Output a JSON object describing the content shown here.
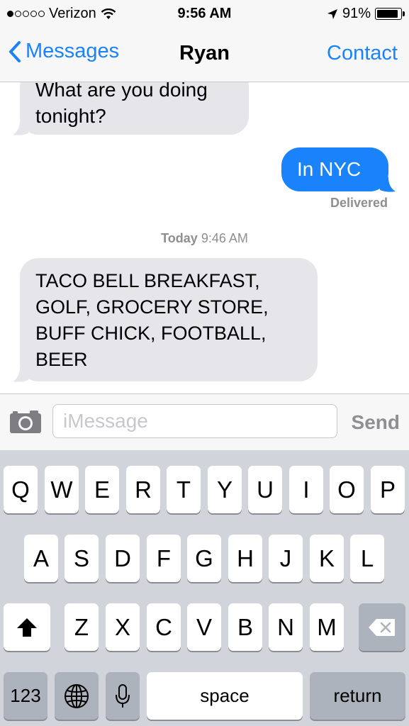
{
  "status_bar": {
    "carrier": "Verizon",
    "signal_bars": 1,
    "time": "9:56 AM",
    "battery": "91%",
    "battery_level": 0.91
  },
  "nav": {
    "back_label": "Messages",
    "title": "Ryan",
    "right_label": "Contact"
  },
  "messages": [
    {
      "direction": "incoming",
      "lines": [
        "What are you doing",
        "tonight?"
      ]
    },
    {
      "direction": "outgoing",
      "text": "In NYC",
      "status": "Delivered"
    },
    {
      "direction": "incoming",
      "lines": [
        "TACO BELL BREAKFAST,",
        "GOLF, GROCERY STORE,",
        "BUFF CHICK, FOOTBALL,",
        "BEER"
      ]
    }
  ],
  "timestamp": {
    "day": "Today",
    "time": "9:46 AM"
  },
  "input": {
    "placeholder": "iMessage",
    "send_label": "Send"
  },
  "keyboard": {
    "row1": [
      "Q",
      "W",
      "E",
      "R",
      "T",
      "Y",
      "U",
      "I",
      "O",
      "P"
    ],
    "row2": [
      "A",
      "S",
      "D",
      "F",
      "G",
      "H",
      "J",
      "K",
      "L"
    ],
    "row3": [
      "Z",
      "X",
      "C",
      "V",
      "B",
      "N",
      "M"
    ],
    "numbers_label": "123",
    "space_label": "space",
    "return_label": "return"
  },
  "colors": {
    "accent": "#1a82fb",
    "incoming_bubble": "#e5e5ea",
    "keyboard_bg": "#d1d5db"
  }
}
